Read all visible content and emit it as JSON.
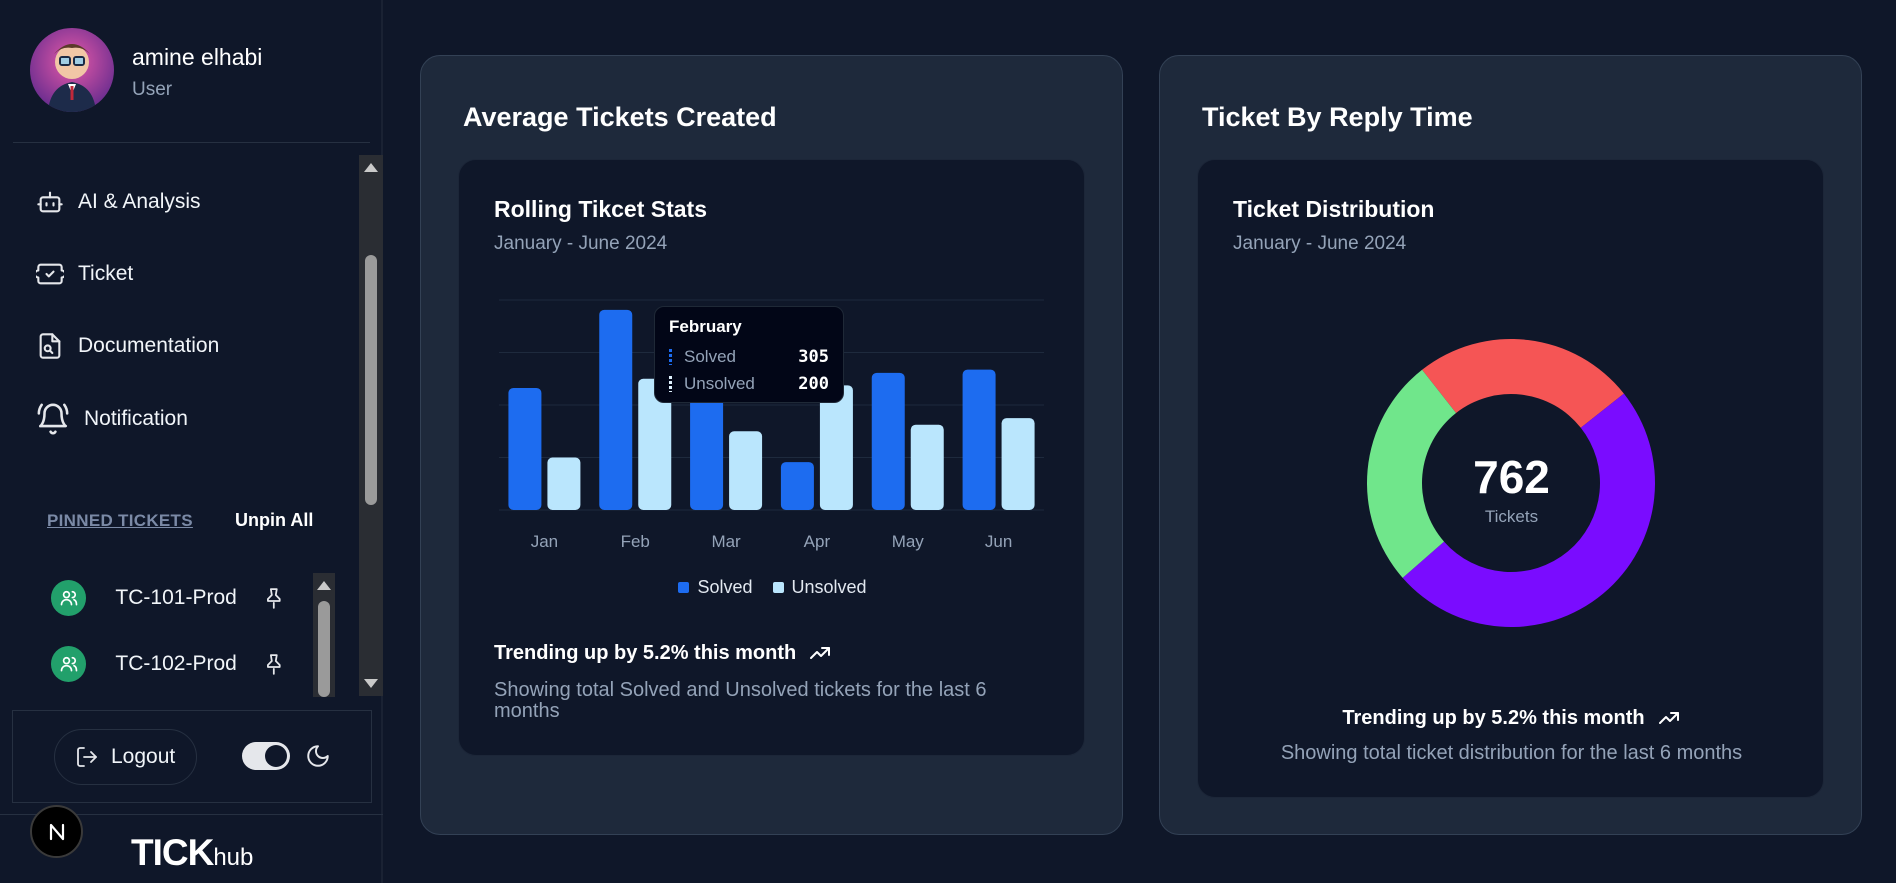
{
  "user": {
    "name": "amine elhabi",
    "role": "User"
  },
  "nav": {
    "items": [
      {
        "label": "AI & Analysis",
        "icon": "robot-icon"
      },
      {
        "label": "Ticket",
        "icon": "ticket-icon"
      },
      {
        "label": "Documentation",
        "icon": "document-icon"
      },
      {
        "label": "Notification",
        "icon": "bell-icon"
      }
    ]
  },
  "pinned": {
    "title": "PINNED TICKETS",
    "unpin_label": "Unpin All",
    "items": [
      {
        "label": "TC-101-Prod",
        "icon": "users-icon"
      },
      {
        "label": "TC-102-Prod",
        "icon": "users-icon"
      }
    ]
  },
  "footer": {
    "logout_label": "Logout",
    "theme": "dark"
  },
  "brand": {
    "name": "TICK",
    "suffix": "hub",
    "badge": "N"
  },
  "colors": {
    "solved": "#1d6cf0",
    "unsolved": "#bae6fd",
    "donut_red": "#f55555",
    "donut_purple": "#7a0cff",
    "donut_green": "#70e68b",
    "avatar_green": "#22a06b"
  },
  "left_card": {
    "title": "Average Tickets Created",
    "chart_title": "Rolling Tikcet Stats",
    "chart_subtitle": "January - June 2024",
    "tooltip": {
      "month": "February",
      "solved_label": "Solved",
      "solved_value": "305",
      "unsolved_label": "Unsolved",
      "unsolved_value": "200"
    },
    "trend": "Trending up by 5.2% this month",
    "description": "Showing total Solved and Unsolved tickets for the last 6 months"
  },
  "right_card": {
    "title": "Ticket By Reply Time",
    "chart_title": "Ticket Distribution",
    "chart_subtitle": "January - June 2024",
    "total": "762",
    "total_label": "Tickets",
    "trend": "Trending up by 5.2% this month",
    "description": "Showing total ticket distribution for the last 6 months"
  },
  "chart_data": [
    {
      "type": "bar",
      "categories": [
        "Jan",
        "Feb",
        "Mar",
        "Apr",
        "May",
        "Jun"
      ],
      "series": [
        {
          "name": "Solved",
          "values": [
            186,
            305,
            237,
            73,
            209,
            214
          ]
        },
        {
          "name": "Unsolved",
          "values": [
            80,
            200,
            120,
            190,
            130,
            140
          ]
        }
      ],
      "ylim": [
        0,
        320
      ],
      "grid": true,
      "legend": "bottom"
    },
    {
      "type": "pie",
      "donut": true,
      "slices": [
        {
          "value": 190
        },
        {
          "value": 375
        },
        {
          "value": 197
        }
      ],
      "total": 762
    }
  ]
}
